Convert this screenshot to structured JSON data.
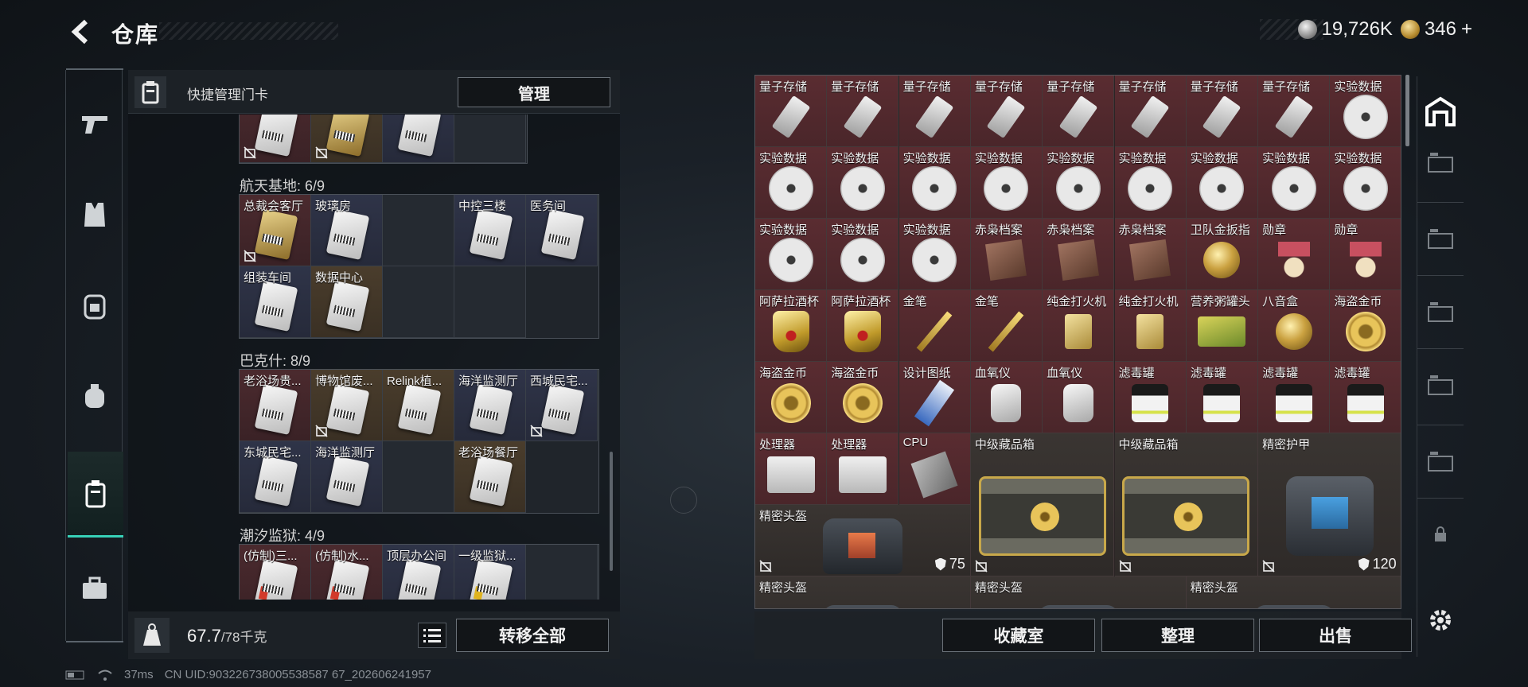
{
  "header": {
    "title": "仓库"
  },
  "currency": {
    "silver": "19,726K",
    "gold": "346",
    "add": "+"
  },
  "left_nav": [
    "weapon-nav",
    "armor-nav",
    "backpack-nav",
    "bag-nav",
    "keycard-nav",
    "toolbox-nav"
  ],
  "keycard_panel": {
    "title": "快捷管理门卡",
    "manage_label": "管理",
    "sections": [
      {
        "name": "",
        "cards": [
          {
            "label": "",
            "type": "r",
            "img": "white",
            "nolock": true
          },
          {
            "label": "",
            "type": "o",
            "img": "gold",
            "nolock": true
          },
          {
            "label": "",
            "type": "b",
            "img": "white",
            "nolock": false
          },
          {
            "label": "",
            "type": "empty"
          }
        ]
      },
      {
        "name": "航天基地: 6/9",
        "cards": [
          {
            "label": "总裁会客厅",
            "type": "r",
            "img": "gold",
            "nolock": true
          },
          {
            "label": "玻璃房",
            "type": "b",
            "img": "white",
            "nolock": false
          },
          {
            "label": "",
            "type": "empty"
          },
          {
            "label": "中控三楼",
            "type": "b",
            "img": "white",
            "nolock": false
          },
          {
            "label": "医务间",
            "type": "b",
            "img": "white",
            "nolock": false
          },
          {
            "label": "组装车间",
            "type": "b",
            "img": "white",
            "nolock": false
          },
          {
            "label": "数据中心",
            "type": "o",
            "img": "white",
            "nolock": false
          },
          {
            "label": "",
            "type": "empty"
          },
          {
            "label": "",
            "type": "empty"
          }
        ]
      },
      {
        "name": "巴克什: 8/9",
        "cards": [
          {
            "label": "老浴场贵...",
            "type": "r",
            "img": "white",
            "nolock": false
          },
          {
            "label": "博物馆废...",
            "type": "o",
            "img": "white",
            "nolock": true
          },
          {
            "label": "Relink植...",
            "type": "o",
            "img": "white",
            "nolock": false
          },
          {
            "label": "海洋监测厅",
            "type": "b",
            "img": "white",
            "nolock": false
          },
          {
            "label": "西城民宅...",
            "type": "b",
            "img": "white",
            "nolock": true
          },
          {
            "label": "东城民宅...",
            "type": "b",
            "img": "white",
            "nolock": false
          },
          {
            "label": "海洋监测厅",
            "type": "b",
            "img": "white",
            "nolock": false
          },
          {
            "label": "",
            "type": "empty"
          },
          {
            "label": "老浴场餐厅",
            "type": "o",
            "img": "white",
            "nolock": false
          }
        ]
      },
      {
        "name": "潮汐监狱: 4/9",
        "cards": [
          {
            "label": "(仿制)三...",
            "type": "r",
            "img": "red",
            "nolock": false
          },
          {
            "label": "(仿制)水...",
            "type": "r",
            "img": "red",
            "nolock": false
          },
          {
            "label": "顶层办公间",
            "type": "b",
            "img": "white",
            "nolock": false
          },
          {
            "label": "一级监狱...",
            "type": "b",
            "img": "yellow",
            "nolock": false
          },
          {
            "label": "",
            "type": "empty"
          }
        ]
      }
    ],
    "weight": {
      "current": "67.7",
      "capacity": "/78千克"
    },
    "transfer_label": "转移全部"
  },
  "inventory": {
    "small_items": [
      {
        "label": "量子存储",
        "icon": "usb"
      },
      {
        "label": "量子存储",
        "icon": "usb"
      },
      {
        "label": "量子存储",
        "icon": "usb"
      },
      {
        "label": "量子存储",
        "icon": "usb"
      },
      {
        "label": "量子存储",
        "icon": "usb"
      },
      {
        "label": "量子存储",
        "icon": "usb"
      },
      {
        "label": "量子存储",
        "icon": "usb"
      },
      {
        "label": "量子存储",
        "icon": "usb"
      },
      {
        "label": "实验数据",
        "icon": "disc"
      },
      {
        "label": "实验数据",
        "icon": "disc"
      },
      {
        "label": "实验数据",
        "icon": "disc"
      },
      {
        "label": "实验数据",
        "icon": "disc"
      },
      {
        "label": "实验数据",
        "icon": "disc"
      },
      {
        "label": "实验数据",
        "icon": "disc"
      },
      {
        "label": "实验数据",
        "icon": "disc"
      },
      {
        "label": "实验数据",
        "icon": "disc"
      },
      {
        "label": "实验数据",
        "icon": "disc"
      },
      {
        "label": "实验数据",
        "icon": "disc"
      },
      {
        "label": "实验数据",
        "icon": "disc"
      },
      {
        "label": "实验数据",
        "icon": "disc"
      },
      {
        "label": "实验数据",
        "icon": "disc"
      },
      {
        "label": "赤枭档案",
        "icon": "photo"
      },
      {
        "label": "赤枭档案",
        "icon": "photo"
      },
      {
        "label": "赤枭档案",
        "icon": "photo"
      },
      {
        "label": "卫队金扳指",
        "icon": "ring"
      },
      {
        "label": "勋章",
        "icon": "medal"
      },
      {
        "label": "勋章",
        "icon": "medal"
      },
      {
        "label": "阿萨拉酒杯",
        "icon": "cup"
      },
      {
        "label": "阿萨拉酒杯",
        "icon": "cup"
      },
      {
        "label": "金笔",
        "icon": "pen"
      },
      {
        "label": "金笔",
        "icon": "pen"
      },
      {
        "label": "纯金打火机",
        "icon": "lighter"
      },
      {
        "label": "纯金打火机",
        "icon": "lighter"
      },
      {
        "label": "营养粥罐头",
        "icon": "tin"
      },
      {
        "label": "八音盒",
        "icon": "ring"
      },
      {
        "label": "海盗金币",
        "icon": "coin"
      },
      {
        "label": "海盗金币",
        "icon": "coin"
      },
      {
        "label": "海盗金币",
        "icon": "coin"
      },
      {
        "label": "设计图纸",
        "icon": "blueprint"
      },
      {
        "label": "血氧仪",
        "icon": "oxi"
      },
      {
        "label": "血氧仪",
        "icon": "oxi"
      },
      {
        "label": "滤毒罐",
        "icon": "filter"
      },
      {
        "label": "滤毒罐",
        "icon": "filter"
      },
      {
        "label": "滤毒罐",
        "icon": "filter"
      },
      {
        "label": "滤毒罐",
        "icon": "filter"
      },
      {
        "label": "处理器",
        "icon": "cpu-box"
      },
      {
        "label": "处理器",
        "icon": "cpu-box"
      },
      {
        "label": "CPU",
        "icon": "chip"
      }
    ],
    "large_items": [
      {
        "label": "中级藏品箱",
        "icon": "chest",
        "durability": ""
      },
      {
        "label": "中级藏品箱",
        "icon": "chest",
        "durability": ""
      },
      {
        "label": "精密护甲",
        "icon": "armor",
        "durability": "120"
      },
      {
        "label": "精密头盔",
        "icon": "helmet",
        "durability": "75"
      }
    ],
    "partial_items": [
      {
        "label": "精密头盔"
      },
      {
        "label": "精密头盔"
      },
      {
        "label": "精密头盔"
      }
    ],
    "buttons": {
      "collection": "收藏室",
      "organize": "整理",
      "sell": "出售"
    }
  },
  "status": {
    "ping": "37ms",
    "uid": "CN UID:903226738005538587 67_202606241957"
  },
  "colors": {
    "accent": "#37d1b8",
    "item_red": "#5a2c31"
  }
}
